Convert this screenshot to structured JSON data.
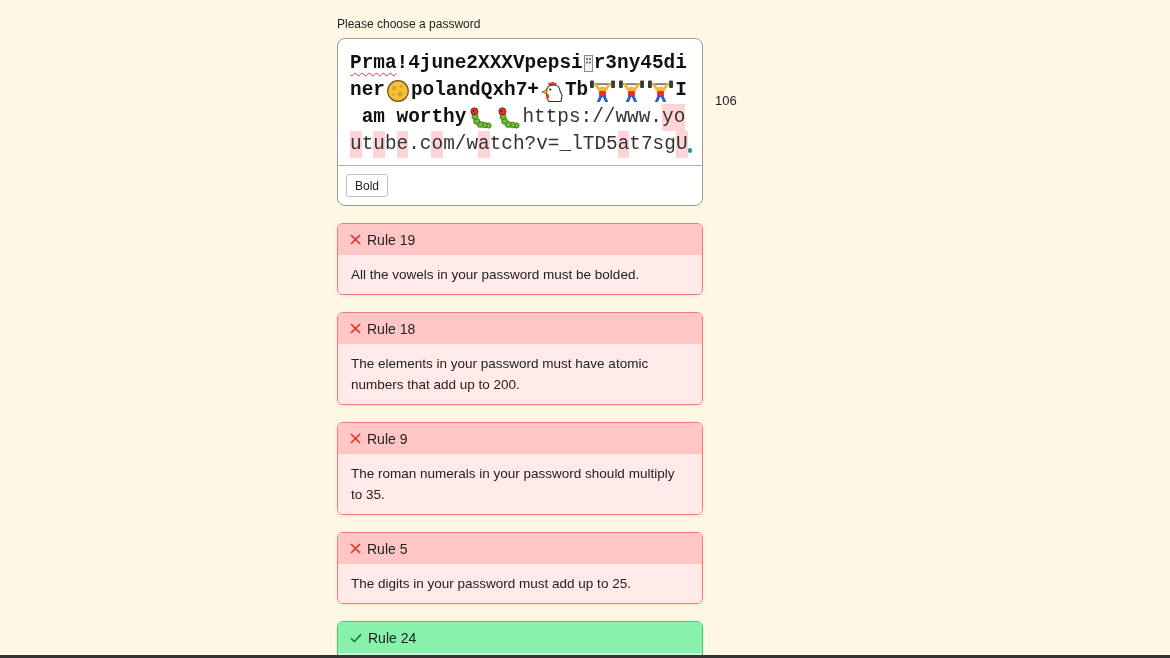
{
  "password": {
    "label": "Please choose a password",
    "lines": [
      [
        {
          "kind": "text",
          "text": "Prma",
          "bold": true,
          "highlighted": false,
          "misspelled": true
        },
        {
          "kind": "text",
          "text": "!4june2XXXVpepsi",
          "bold": true,
          "highlighted": false,
          "misspelled": false
        },
        {
          "kind": "unknown_glyph"
        },
        {
          "kind": "text",
          "text": "r3ny45di",
          "bold": true,
          "highlighted": false,
          "misspelled": false
        }
      ],
      [
        {
          "kind": "text",
          "text": "ner",
          "bold": true,
          "highlighted": false,
          "misspelled": false
        },
        {
          "kind": "moon"
        },
        {
          "kind": "text",
          "text": "polandQxh7+",
          "bold": true,
          "highlighted": false,
          "misspelled": false
        },
        {
          "kind": "chicken"
        },
        {
          "kind": "text",
          "text": "Tb",
          "bold": true,
          "highlighted": false,
          "misspelled": false
        },
        {
          "kind": "weightlifter"
        },
        {
          "kind": "weightlifter"
        },
        {
          "kind": "weightlifter"
        },
        {
          "kind": "text",
          "text": "I",
          "bold": true,
          "highlighted": false,
          "misspelled": false
        }
      ],
      [
        {
          "kind": "text",
          "text": " am worthy",
          "bold": true,
          "highlighted": false,
          "misspelled": false
        },
        {
          "kind": "caterpillar"
        },
        {
          "kind": "caterpillar"
        },
        {
          "kind": "text",
          "text": "https://www.",
          "bold": false,
          "highlighted": false,
          "misspelled": false
        },
        {
          "kind": "text",
          "text": "yo",
          "bold": false,
          "highlighted": true,
          "misspelled": false
        }
      ],
      [
        {
          "kind": "text",
          "text": "u",
          "bold": false,
          "highlighted": true,
          "misspelled": false
        },
        {
          "kind": "text",
          "text": "t",
          "bold": false,
          "highlighted": false,
          "misspelled": false
        },
        {
          "kind": "text",
          "text": "u",
          "bold": false,
          "highlighted": true,
          "misspelled": false
        },
        {
          "kind": "text",
          "text": "b",
          "bold": false,
          "highlighted": false,
          "misspelled": false
        },
        {
          "kind": "text",
          "text": "e",
          "bold": false,
          "highlighted": true,
          "misspelled": false
        },
        {
          "kind": "text",
          "text": ".c",
          "bold": false,
          "highlighted": false,
          "misspelled": false
        },
        {
          "kind": "text",
          "text": "o",
          "bold": false,
          "highlighted": true,
          "misspelled": false
        },
        {
          "kind": "text",
          "text": "m/w",
          "bold": false,
          "highlighted": false,
          "misspelled": false
        },
        {
          "kind": "text",
          "text": "a",
          "bold": false,
          "highlighted": true,
          "misspelled": false
        },
        {
          "kind": "text",
          "text": "tch?v=_lTD5",
          "bold": false,
          "highlighted": false,
          "misspelled": false
        },
        {
          "kind": "text",
          "text": "a",
          "bold": false,
          "highlighted": true,
          "misspelled": false
        },
        {
          "kind": "text",
          "text": "t7sg",
          "bold": false,
          "highlighted": false,
          "misspelled": false
        },
        {
          "kind": "text",
          "text": "U",
          "bold": false,
          "highlighted": true,
          "misspelled": false
        }
      ]
    ],
    "caret_visible": true,
    "length": "106",
    "toolbar": [
      "Bold"
    ]
  },
  "rules": [
    {
      "title": "Rule 19",
      "text": "All the vowels in your password must be bolded.",
      "passed": false
    },
    {
      "title": "Rule 18",
      "text": "The elements in your password must have atomic numbers that add up to 200.",
      "passed": false
    },
    {
      "title": "Rule 9",
      "text": "The roman numerals in your password should multiply to 35.",
      "passed": false
    },
    {
      "title": "Rule 5",
      "text": "The digits in your password must add up to 25.",
      "passed": false
    },
    {
      "title": "Rule 24",
      "passed": true
    }
  ]
}
